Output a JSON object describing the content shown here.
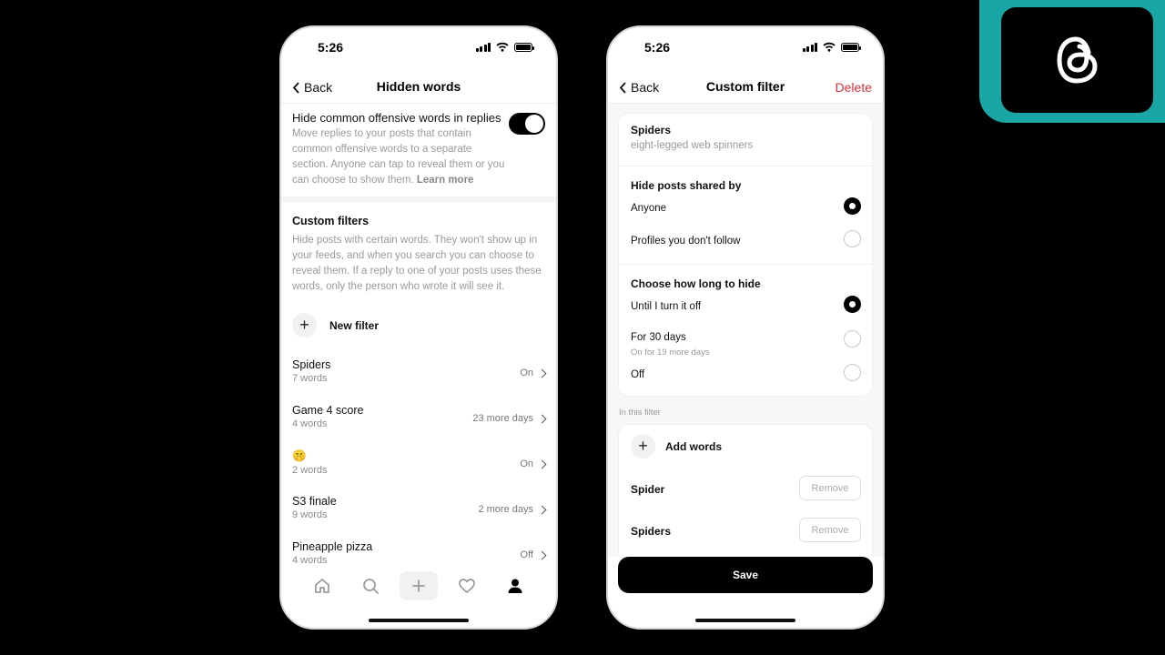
{
  "left_phone": {
    "status_time": "5:26",
    "nav": {
      "back_label": "Back",
      "title": "Hidden words"
    },
    "offensive": {
      "title": "Hide common offensive words in replies",
      "description": "Move replies to your posts that contain common offensive words to a separate section. Anyone can tap to reveal them or you can choose to show them.",
      "learn_more": "Learn more",
      "toggle_on": true
    },
    "custom_filters": {
      "heading": "Custom filters",
      "description": "Hide posts with certain words. They won't show up in your feeds, and when you search you can choose to reveal them. If a reply to one of your posts uses these words, only the person who wrote it will see it.",
      "new_filter_label": "New filter"
    },
    "filters": [
      {
        "name": "Spiders",
        "count": "7 words",
        "status": "On"
      },
      {
        "name": "Game 4 score",
        "count": "4 words",
        "status": "23 more days"
      },
      {
        "name": "🤫",
        "count": "2 words",
        "status": "On"
      },
      {
        "name": "S3 finale",
        "count": "9 words",
        "status": "2 more days"
      },
      {
        "name": "Pineapple pizza",
        "count": "4 words",
        "status": "Off"
      }
    ],
    "tabbar_icons": [
      "home-icon",
      "search-icon",
      "plus-icon",
      "heart-icon",
      "profile-icon"
    ]
  },
  "right_phone": {
    "status_time": "5:26",
    "nav": {
      "back_label": "Back",
      "title": "Custom filter",
      "delete_label": "Delete"
    },
    "filter": {
      "name": "Spiders",
      "description": "eight-legged web spinners"
    },
    "hide_shared_by": {
      "heading": "Hide posts shared by",
      "options": [
        {
          "label": "Anyone",
          "selected": true
        },
        {
          "label": "Profiles you don't follow",
          "selected": false
        }
      ]
    },
    "duration": {
      "heading": "Choose how long to hide",
      "options": [
        {
          "label": "Until I turn it off",
          "sub": "",
          "selected": true
        },
        {
          "label": "For 30 days",
          "sub": "On for 19 more days",
          "selected": false
        },
        {
          "label": "Off",
          "sub": "",
          "selected": false
        }
      ]
    },
    "in_filter_label": "In this filter",
    "add_words_label": "Add words",
    "words": [
      {
        "word": "Spider",
        "remove_label": "Remove"
      },
      {
        "word": "Spiders",
        "remove_label": "Remove"
      }
    ],
    "save_label": "Save"
  },
  "colors": {
    "accent_delete": "#e0303a",
    "badge_teal": "#1aa6a4"
  }
}
